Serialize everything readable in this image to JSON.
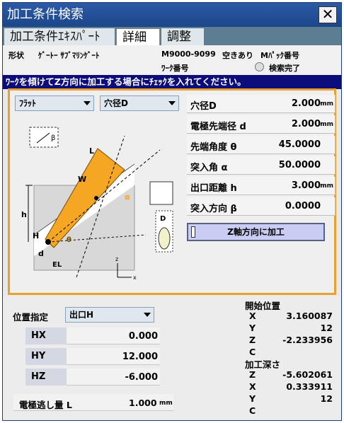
{
  "window": {
    "title": "加工条件検索",
    "close_glyph": "✕"
  },
  "tabs": [
    {
      "label": "加工条件ｴｷｽﾊﾟｰﾄ"
    },
    {
      "label": "詳細"
    },
    {
      "label": "調整"
    }
  ],
  "info": {
    "shape_label": "形状",
    "shape_value": "ｹﾞｰﾄｰ ｻﾌﾞﾏﾘﾝｹﾞｰﾄ",
    "code": "M9000-9099",
    "availability": "空きあり",
    "mpack_label": "Mﾊﾟｯｸ番号",
    "work_label": "ﾜｰｸ番号",
    "search_status": "検索完了"
  },
  "notice": "ﾜｰｸを傾けてZ方向に加工する場合にﾁｪｯｸを入れてください。",
  "selectors": {
    "shape": "ﾌﾗｯﾄ",
    "hole": "穴径D"
  },
  "params": [
    {
      "label": "穴径D",
      "value": "2.000",
      "unit": "mm"
    },
    {
      "label": "電極先端径 d",
      "value": "2.000",
      "unit": "mm"
    },
    {
      "label": "先端角度 θ",
      "value": "45.0000",
      "unit": ""
    },
    {
      "label": "突入角 α",
      "value": "50.0000",
      "unit": ""
    },
    {
      "label": "出口距離 h",
      "value": "3.000",
      "unit": "mm"
    },
    {
      "label": "突入方向 β",
      "value": "0.0000",
      "unit": ""
    }
  ],
  "z_button": "Z軸方向に加工",
  "diagram": {
    "L": "L",
    "W": "W",
    "h": "h",
    "H": "H",
    "d": "d",
    "EL": "EL",
    "theta": "θ",
    "alpha": "α",
    "beta": "β",
    "D": "D",
    "x": "x",
    "z": "z"
  },
  "position": {
    "label": "位置指定",
    "selected": "出口H",
    "fields": [
      {
        "tag": "HX",
        "value": "0.000"
      },
      {
        "tag": "HY",
        "value": "12.000"
      },
      {
        "tag": "HZ",
        "value": "-6.000"
      }
    ],
    "electrode_label": "電極逃し量 L",
    "electrode_value": "1.000",
    "electrode_unit": "mm"
  },
  "start": {
    "title": "開始位置",
    "rows": [
      {
        "axis": "X",
        "value": "3.160087"
      },
      {
        "axis": "Y",
        "value": "12"
      },
      {
        "axis": "Z",
        "value": "-2.233956"
      },
      {
        "axis": "C",
        "value": ""
      }
    ]
  },
  "depth": {
    "title": "加工深さ",
    "rows": [
      {
        "axis": "Z",
        "value": "-5.602061"
      },
      {
        "axis": "X",
        "value": "0.333911"
      },
      {
        "axis": "Y",
        "value": "12"
      },
      {
        "axis": "C",
        "value": ""
      }
    ]
  },
  "colors": {
    "title_bar": "#1d4689",
    "notice_bg": "#0c0c7a",
    "panel_border": "#e8a12c",
    "electrode_fill": "#f5a623"
  }
}
